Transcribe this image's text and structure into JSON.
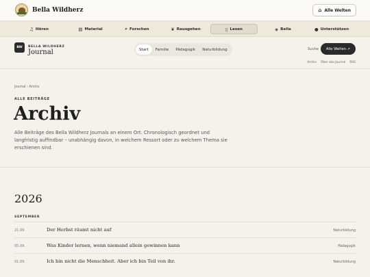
{
  "brand": {
    "name": "Bella Wildherz"
  },
  "topbar": {
    "worlds_label": "Alle Welten"
  },
  "nav": [
    {
      "label": "Hören",
      "icon": "headphones-icon",
      "glyph": "♫",
      "active": false
    },
    {
      "label": "Material",
      "icon": "book-icon",
      "glyph": "▤",
      "active": false
    },
    {
      "label": "Forschen",
      "icon": "magnifier-icon",
      "glyph": "⌕",
      "active": false
    },
    {
      "label": "Rausgehen",
      "icon": "leaf-icon",
      "glyph": "❦",
      "active": false
    },
    {
      "label": "Lesen",
      "icon": "open-book-icon",
      "glyph": "▯",
      "active": true
    },
    {
      "label": "Bella",
      "icon": "shield-icon",
      "glyph": "◈",
      "active": false
    },
    {
      "label": "Unterstützen",
      "icon": "apple-icon",
      "glyph": "●",
      "active": false
    }
  ],
  "journal": {
    "badge": "BW",
    "kicker": "BELLA WILDHERZ",
    "title": "Journal",
    "tabs": [
      "Start",
      "Familie",
      "Pädagogik",
      "Naturbildung"
    ],
    "search_label": "Suche",
    "worlds_label": "Alle Welten ↗",
    "sublinks": [
      "Archiv",
      "Über das Journal",
      "RSS"
    ]
  },
  "page": {
    "breadcrumb": "Journal › Archiv",
    "kicker": "ALLE BEITRÄGE",
    "title": "Archiv",
    "intro": "Alle Beiträge des Bella Wildherz Journals an einem Ort. Chronologisch geordnet und langfristig auffindbar – unabhängig davon, in welchem Ressort oder zu welchem Thema sie erschienen sind."
  },
  "archive": {
    "year": "2026",
    "month": "SEPTEMBER",
    "entries": [
      {
        "date": "21.09.",
        "title": "Der Herbst räumt nicht auf",
        "category": "Naturbildung"
      },
      {
        "date": "05.09.",
        "title": "Was Kinder lernen, wenn niemand allein gewinnen kann",
        "category": "Pädagogik"
      },
      {
        "date": "01.09.",
        "title": "Ich bin nicht die Menschheit. Aber ich bin Teil von ihr.",
        "category": "Naturbildung"
      }
    ]
  }
}
